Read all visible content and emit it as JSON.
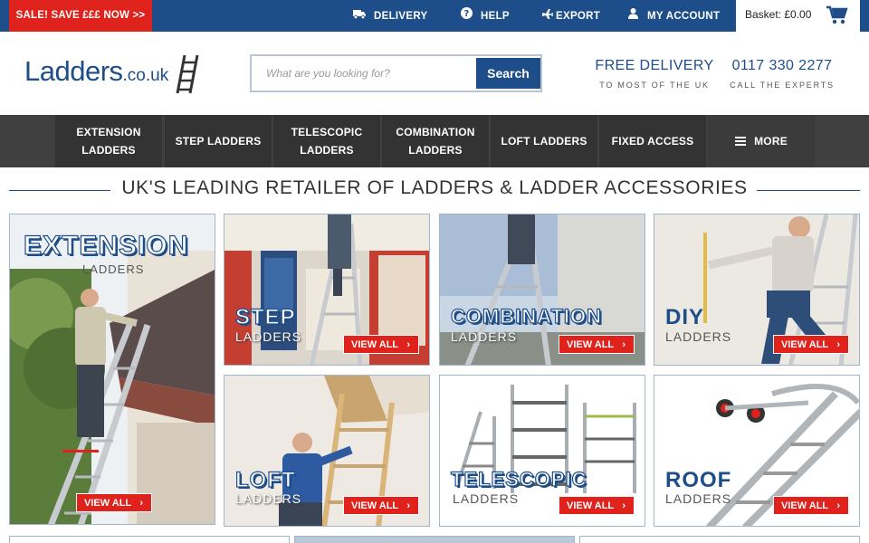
{
  "topbar": {
    "sale": "SALE! SAVE £££ NOW >>",
    "links": [
      {
        "icon": "truck-icon",
        "label": "DELIVERY"
      },
      {
        "icon": "help-icon",
        "label": "HELP"
      },
      {
        "icon": "plane-icon",
        "label": "EXPORT"
      },
      {
        "icon": "user-icon",
        "label": "MY ACCOUNT"
      }
    ],
    "basket": "Basket: £0.00"
  },
  "header": {
    "logo_main": "Ladders",
    "logo_suffix": ".co.uk",
    "search_placeholder": "What are you looking for?",
    "search_button": "Search",
    "promo1_big": "FREE DELIVERY",
    "promo1_small": "TO MOST OF THE UK",
    "promo2_big": "0117 330 2277",
    "promo2_small": "CALL THE EXPERTS"
  },
  "nav": [
    {
      "line1": "EXTENSION",
      "line2": "LADDERS"
    },
    {
      "line1": "STEP LADDERS",
      "line2": ""
    },
    {
      "line1": "TELESCOPIC",
      "line2": "LADDERS"
    },
    {
      "line1": "COMBINATION",
      "line2": "LADDERS"
    },
    {
      "line1": "LOFT LADDERS",
      "line2": ""
    },
    {
      "line1": "FIXED ACCESS",
      "line2": ""
    },
    {
      "line1": "MORE",
      "line2": ""
    }
  ],
  "heading": "UK'S LEADING RETAILER OF LADDERS & LADDER ACCESSORIES",
  "tiles": {
    "extension": {
      "title": "EXTENSION",
      "sub": "LADDERS",
      "cta": "VIEW ALL"
    },
    "step": {
      "title": "STEP",
      "sub": "LADDERS",
      "cta": "VIEW ALL"
    },
    "combination": {
      "title": "COMBINATION",
      "sub": "LADDERS",
      "cta": "VIEW ALL"
    },
    "diy": {
      "title": "DIY",
      "sub": "LADDERS",
      "cta": "VIEW ALL"
    },
    "loft": {
      "title": "LOFT",
      "sub": "LADDERS",
      "cta": "VIEW ALL"
    },
    "telescopic": {
      "title": "TELESCOPIC",
      "sub": "LADDERS",
      "cta": "VIEW ALL"
    },
    "roof": {
      "title": "ROOF",
      "sub": "LADDERS",
      "cta": "VIEW ALL"
    }
  },
  "colors": {
    "brand_blue": "#1e4e8a",
    "sale_red": "#e0221c",
    "nav_dark": "#333333"
  }
}
